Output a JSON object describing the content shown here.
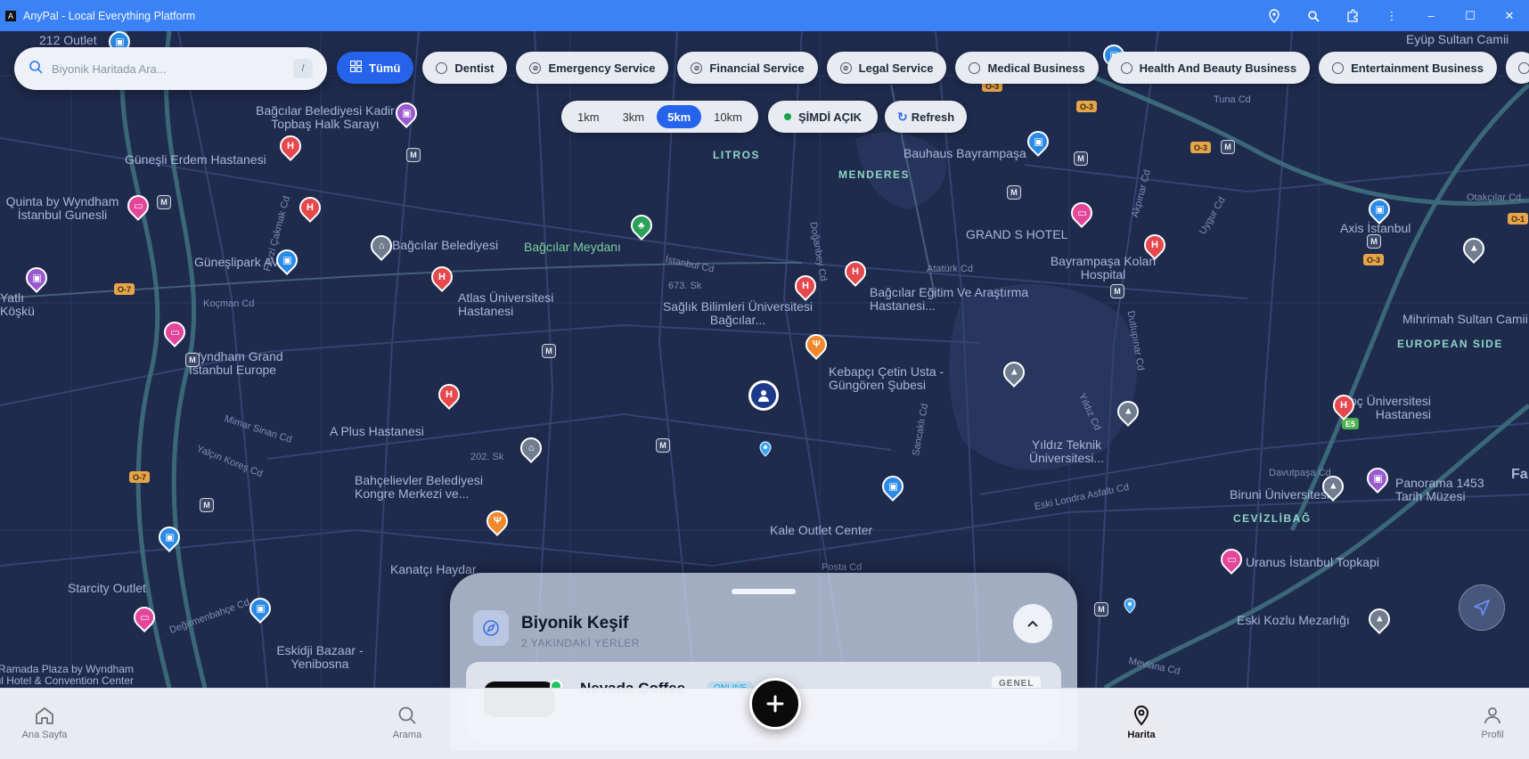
{
  "window": {
    "title": "AnyPal - Local Everything Platform",
    "app_icon": "A"
  },
  "search": {
    "placeholder": "Biyonik Haritada Ara...",
    "shortcut": "/"
  },
  "filters": [
    {
      "label": "Tümü",
      "active": true
    },
    {
      "label": "Dentist"
    },
    {
      "label": "Emergency Service"
    },
    {
      "label": "Financial Service"
    },
    {
      "label": "Legal Service"
    },
    {
      "label": "Medical Business"
    },
    {
      "label": "Health And Beauty Business"
    },
    {
      "label": "Entertainment Business"
    }
  ],
  "distances": [
    "1km",
    "3km",
    "5km",
    "10km"
  ],
  "distance_selected": "5km",
  "open_now": "ŞİMDİ AÇIK",
  "refresh": "Refresh",
  "map": {
    "labels": {
      "l1": "212 Outlet",
      "l2": "Bağcılar Belediyesi Kadir Topbaş Halk Sarayı",
      "l3": "Güneşli Erdem Hastanesi",
      "l4": "Quinta by Wyndham İstanbul Gunesli",
      "l5": "Bağcılar Belediyesi",
      "l6": "Güneşlipark AVM",
      "l7": "Atlas Üniversitesi Hastanesi",
      "l8": "Bağcılar Meydanı",
      "l9": "Sağlık Bilimleri Üniversitesi Bağcılar...",
      "l10": "Bağcılar Eğitim Ve Araştırma Hastanesi...",
      "l11": "Wyndham Grand İstanbul Europe",
      "l12": "Kebapçı Çetin Usta - Güngören Şubesi",
      "l13": "A Plus Hastanesi",
      "l14": "Bahçelievler Belediyesi Kongre Merkezi ve...",
      "l15": "Kale Outlet Center",
      "l16": "Kanatçı Haydar",
      "l17": "Starcity Outlet",
      "l18": "Eskidji Bazaar - Yenibosna",
      "l19": "Ramada Plaza by Wyndham İstanbul Hotel & Convention Center",
      "l20": "Bauhaus Bayrampaşa",
      "l21": "GRAND S HOTEL",
      "l22": "Bayrampaşa Kolan Hospital",
      "l23": "Axis İstanbul",
      "l24": "Mihrimah Sultan Camii",
      "l25": "Koç Üniversitesi Hastanesi",
      "l26": "Yıldız Teknik Üniversitesi...",
      "l27": "Biruni Üniversitesi",
      "l28": "Panorama 1453 Tarih Müzesi",
      "l29": "Uranus İstanbul Topkapi",
      "l30": "Eski Kozlu Mezarlığı",
      "l31": "Eyüp Sultan Camii",
      "l32": "Otakçılar Cd.",
      "l33": "Yatlı Köşkü",
      "l34": "Fa"
    },
    "districts": {
      "d1": "LITROS",
      "d2": "MENDERES",
      "d3": "EUROPEAN SIDE",
      "d4": "CEVİZLİBAĞ"
    },
    "streets": {
      "s1": "673. Sk",
      "s2": "202. Sk",
      "s3": "Koçman Cd",
      "s4": "Mimar Sinan Cd",
      "s5": "Yalçın Koreş Cd",
      "s6": "Atatürk Cd",
      "s7": "Dutlupınar Cd",
      "s8": "Eski Londra Asfaltı Cd",
      "s9": "Mevlana Cd",
      "s10": "Davutpaşa Cd",
      "s11": "Fevzi Çakmak Cd",
      "s12": "İstanbul Cd",
      "s13": "Posta Cd",
      "s14": "Değirmenbahçe Cd",
      "s15": "Yıldız Cd",
      "s16": "Tuna Cd",
      "s17": "Sancaklı Cd",
      "s18": "Akpınar Cd",
      "s19": "Uygur Cd",
      "s20": "Doğanbey Cd"
    },
    "shields": {
      "r1": "O-3",
      "r2": "O-3",
      "r3": "O-3",
      "r4": "O-3",
      "r5": "O-7",
      "r6": "O-7",
      "r7": "E5",
      "r8": "O-1"
    },
    "metro_icon": "M"
  },
  "sheet": {
    "title": "Biyonik Keşif",
    "subtitle": "2 YAKINDAKİ YERLER",
    "card": {
      "name": "Nevada Coffee",
      "tag": "ONLINE",
      "category": "GENEL"
    }
  },
  "nav": {
    "home": "Ana Sayfa",
    "search": "Arama",
    "map": "Harita",
    "profile": "Profil"
  },
  "colors": {
    "accent": "#2563eb",
    "titlebar": "#3b82f6",
    "map_bg": "#1f2b4d",
    "online": "#22c55e"
  }
}
